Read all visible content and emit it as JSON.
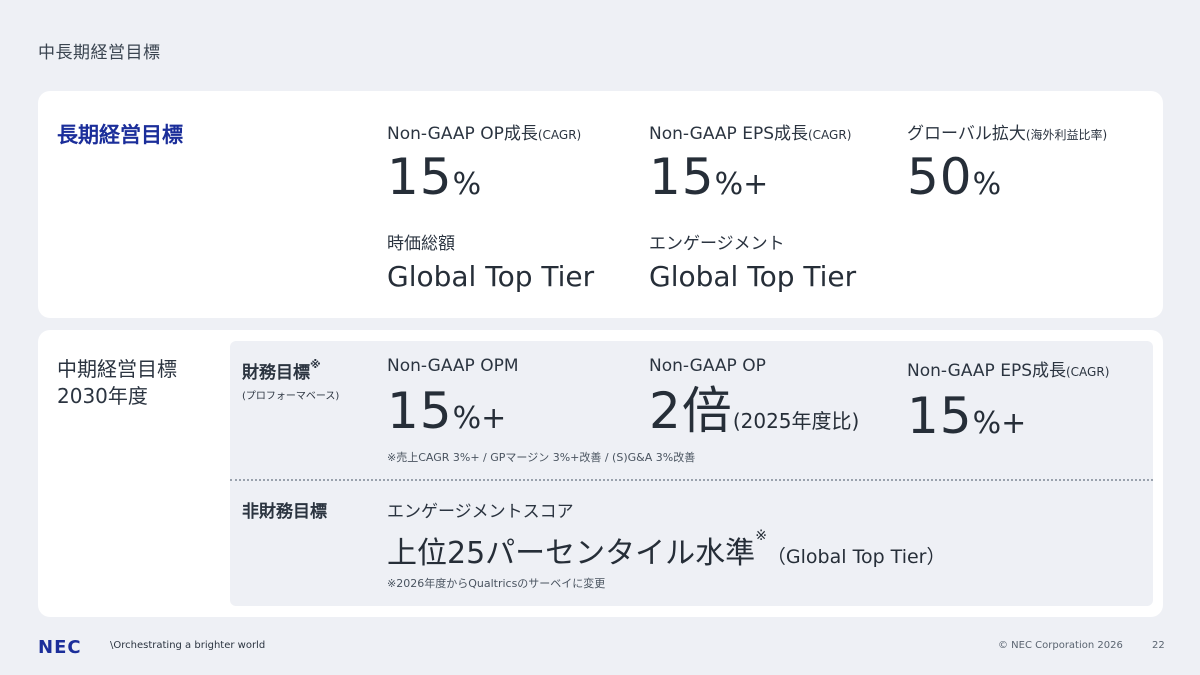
{
  "page_title": "中長期経営目標",
  "long_term": {
    "title": "長期経営目標",
    "metrics": [
      {
        "label": "Non-GAAP OP成長",
        "sub": "(CAGR)",
        "value": "15",
        "unit": "%"
      },
      {
        "label": "Non-GAAP EPS成長",
        "sub": "(CAGR)",
        "value": "15",
        "unit": "%+"
      },
      {
        "label": "グローバル拡大",
        "sub": "(海外利益比率)",
        "value": "50",
        "unit": "%"
      }
    ],
    "qualitative": [
      {
        "label": "時価総額",
        "value": "Global Top Tier"
      },
      {
        "label": "エンゲージメント",
        "value": "Global Top Tier"
      }
    ]
  },
  "mid_term": {
    "title_line1": "中期経営目標",
    "title_line2": "2030年度",
    "financial": {
      "label": "財務目標",
      "mark": "※",
      "sub": "(プロフォーマベース)",
      "metrics": [
        {
          "label": "Non-GAAP OPM",
          "sub": "",
          "value": "15",
          "unit": "%+"
        },
        {
          "label": "Non-GAAP OP",
          "sub": "",
          "value": "2倍",
          "unit": "(2025年度比)"
        },
        {
          "label": "Non-GAAP EPS成長",
          "sub": "(CAGR)",
          "value": "15",
          "unit": "%+"
        }
      ],
      "note": "※売上CAGR 3%+ / GPマージン 3%+改善 / (S)G&A 3%改善"
    },
    "non_financial": {
      "label": "非財務目標",
      "metric_label": "エンゲージメントスコア",
      "value": "上位25パーセンタイル水準",
      "mark": "※",
      "paren": "（Global Top Tier）",
      "note": "※2026年度からQualtricsのサーベイに変更"
    }
  },
  "footer": {
    "logo": "NEC",
    "tagline": "\\Orchestrating a brighter world",
    "copyright": "© NEC Corporation 2026",
    "page": "22"
  }
}
